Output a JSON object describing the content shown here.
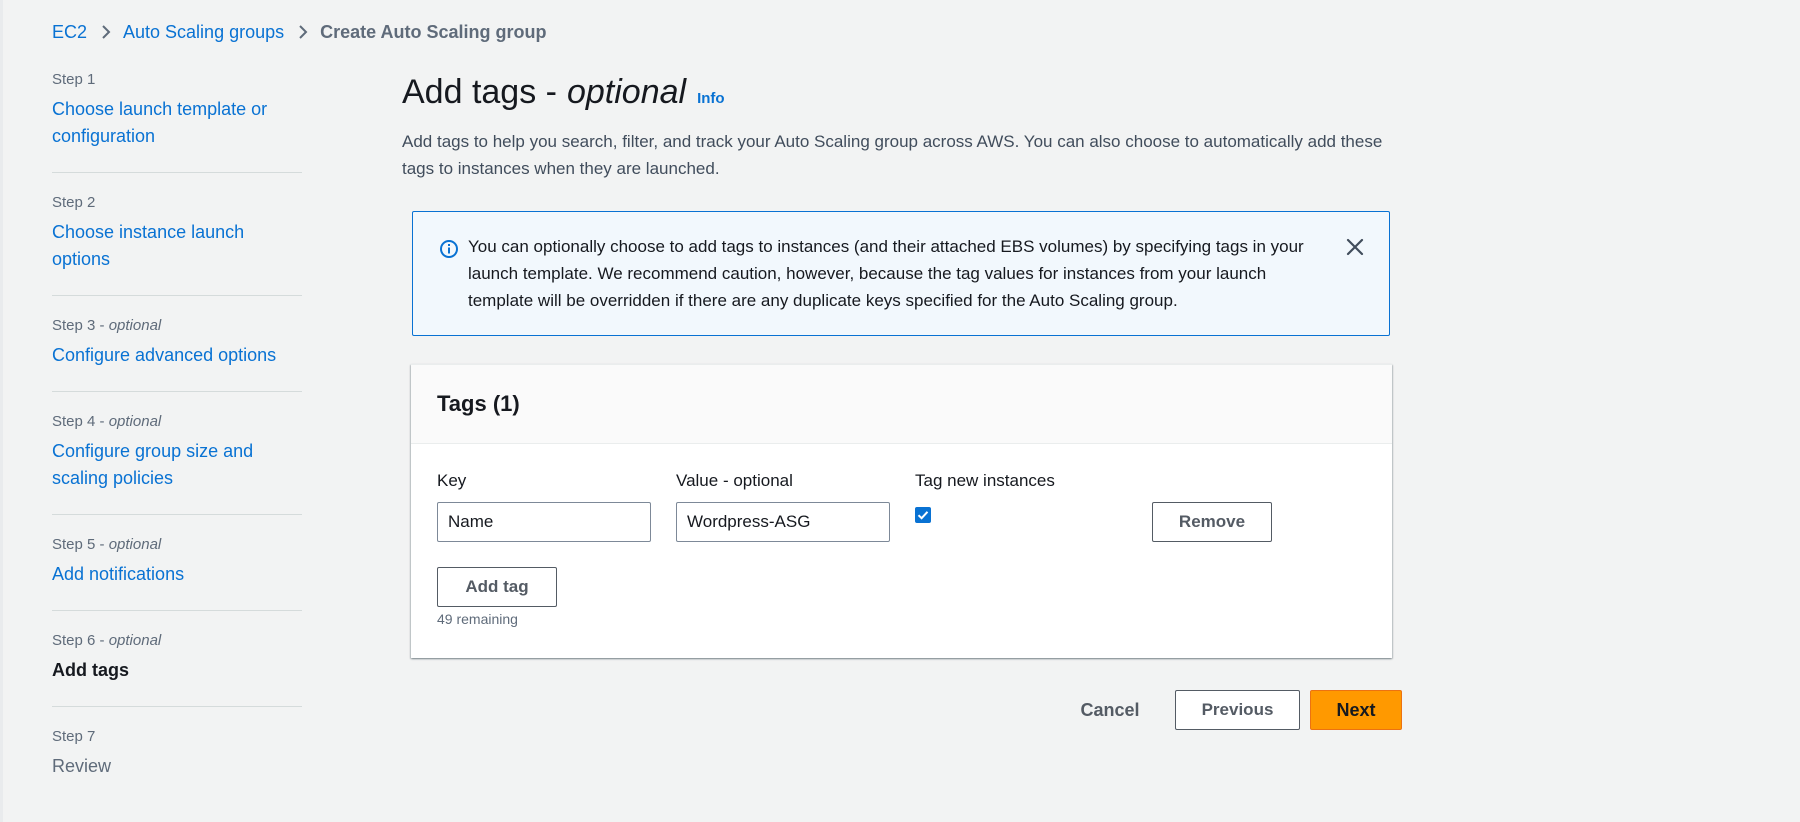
{
  "breadcrumb": {
    "items": [
      "EC2",
      "Auto Scaling groups"
    ],
    "current": "Create Auto Scaling group"
  },
  "steps": [
    {
      "number": "Step 1",
      "optional": "",
      "label": "Choose launch template or configuration",
      "state": "link"
    },
    {
      "number": "Step 2",
      "optional": "",
      "label": "Choose instance launch options",
      "state": "link"
    },
    {
      "number": "Step 3 - ",
      "optional": "optional",
      "label": "Configure advanced options",
      "state": "link"
    },
    {
      "number": "Step 4 - ",
      "optional": "optional",
      "label": "Configure group size and scaling policies",
      "state": "link"
    },
    {
      "number": "Step 5 - ",
      "optional": "optional",
      "label": "Add notifications",
      "state": "link"
    },
    {
      "number": "Step 6 - ",
      "optional": "optional",
      "label": "Add tags",
      "state": "current"
    },
    {
      "number": "Step 7",
      "optional": "",
      "label": "Review",
      "state": "disabled"
    }
  ],
  "header": {
    "title": "Add tags -",
    "title_optional": "optional",
    "info_label": "Info",
    "description": "Add tags to help you search, filter, and track your Auto Scaling group across AWS. You can also choose to automatically add these tags to instances when they are launched."
  },
  "alert": {
    "text": "You can optionally choose to add tags to instances (and their attached EBS volumes) by specifying tags in your launch template. We recommend caution, however, because the tag values for instances from your launch template will be overridden if there are any duplicate keys specified for the Auto Scaling group.",
    "icon": "info-circle-icon",
    "close_icon": "close-icon"
  },
  "tags": {
    "title": "Tags (1)",
    "columns": {
      "key": "Key",
      "value": "Value - optional",
      "tag_new": "Tag new instances"
    },
    "rows": [
      {
        "key": "Name",
        "value": "Wordpress-ASG",
        "tag_new_instances": true
      }
    ],
    "remove_label": "Remove",
    "add_label": "Add tag",
    "remaining": "49 remaining"
  },
  "footer": {
    "cancel_label": "Cancel",
    "previous_label": "Previous",
    "next_label": "Next"
  },
  "colors": {
    "link": "#0972d3",
    "primary_button": "#ff9900",
    "alert_border": "#0972d3",
    "alert_background": "#f2f8fd",
    "page_background": "#f2f3f3"
  }
}
